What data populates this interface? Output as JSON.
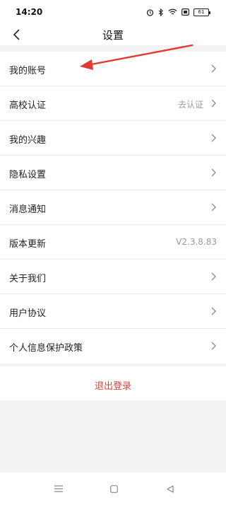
{
  "status_bar": {
    "time": "14:20",
    "icons": [
      "alarm-icon",
      "bluetooth-icon",
      "wifi-icon",
      "sim-icon",
      "battery-icon"
    ],
    "battery_level": "61"
  },
  "nav": {
    "title": "设置",
    "back_icon": "chevron-left-icon"
  },
  "settings": {
    "items": [
      {
        "label": "我的账号",
        "value": "",
        "chevron": true
      },
      {
        "label": "高校认证",
        "value": "去认证",
        "chevron": true
      },
      {
        "label": "我的兴趣",
        "value": "",
        "chevron": true
      },
      {
        "label": "隐私设置",
        "value": "",
        "chevron": true
      },
      {
        "label": "消息通知",
        "value": "",
        "chevron": true
      },
      {
        "label": "版本更新",
        "value": "V2.3.8.83",
        "chevron": false
      },
      {
        "label": "关于我们",
        "value": "",
        "chevron": true
      },
      {
        "label": "用户协议",
        "value": "",
        "chevron": true
      },
      {
        "label": "个人信息保护政策",
        "value": "",
        "chevron": true
      }
    ]
  },
  "logout": {
    "label": "退出登录",
    "color": "#e0413a"
  },
  "system_nav": {
    "icons": [
      "menu-icon",
      "home-icon",
      "back-triangle-icon"
    ]
  },
  "annotation": {
    "arrow_color": "#e53935",
    "points_to": "我的账号"
  }
}
